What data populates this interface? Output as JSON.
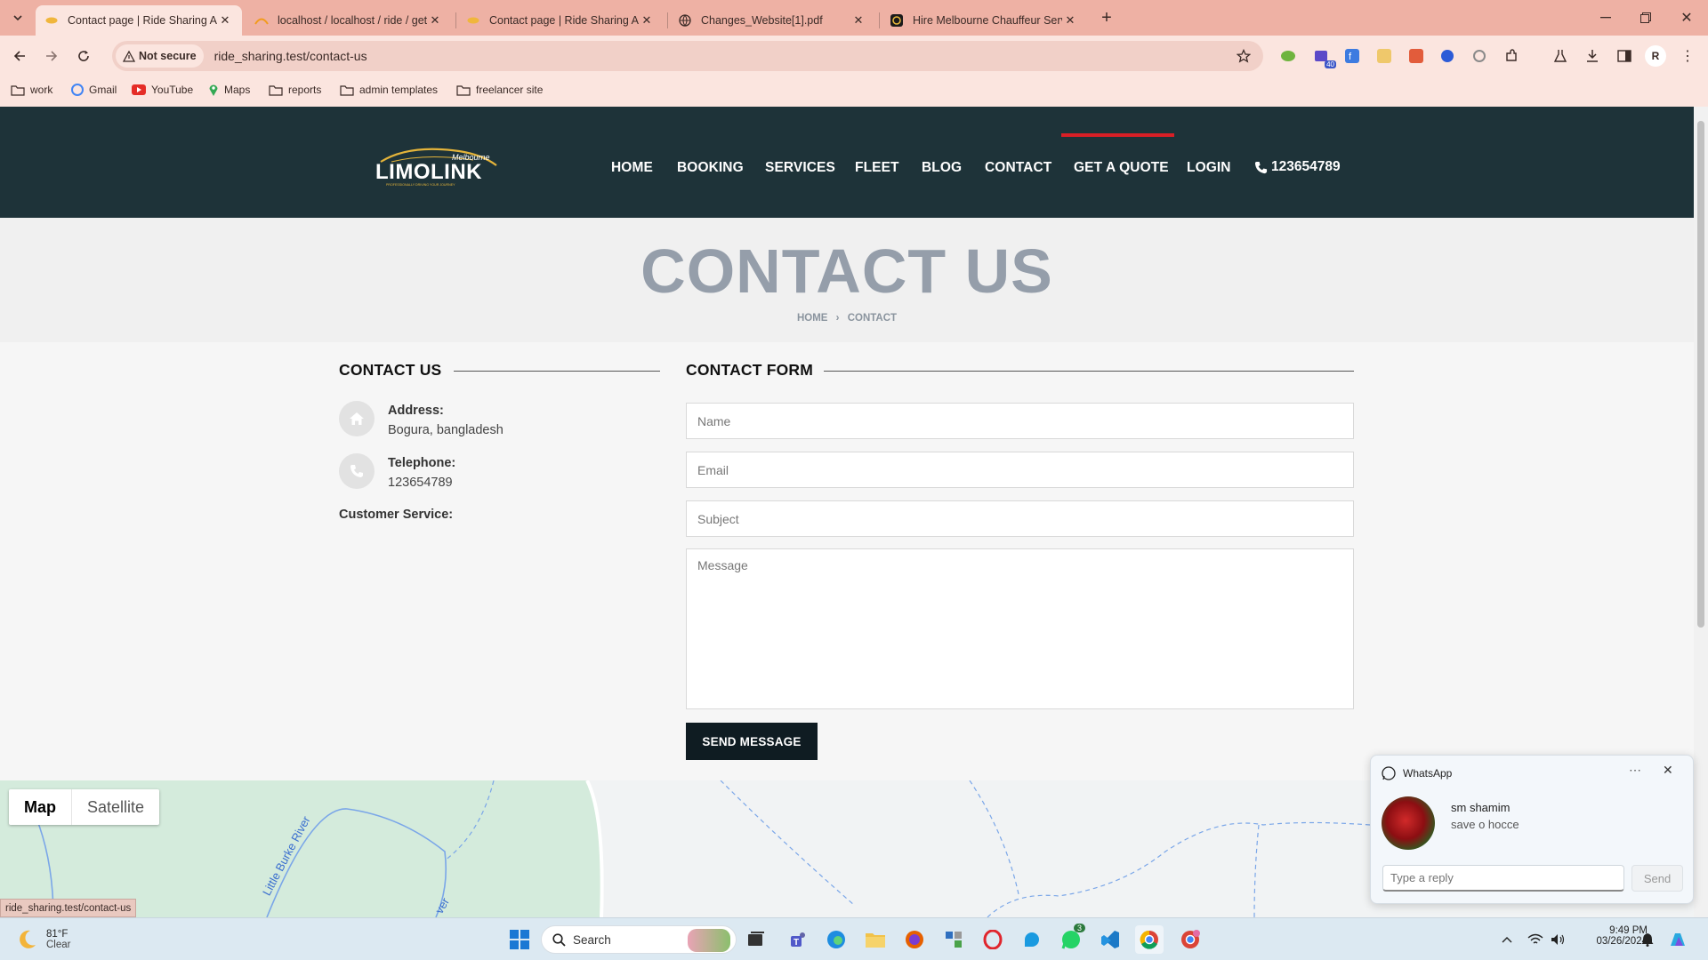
{
  "browser": {
    "tabs": [
      {
        "title": "Contact page | Ride Sharing Ap",
        "active": true
      },
      {
        "title": "localhost / localhost / ride / get",
        "active": false
      },
      {
        "title": "Contact page | Ride Sharing Ap",
        "active": false
      },
      {
        "title": "Changes_Website[1].pdf",
        "active": false
      },
      {
        "title": "Hire Melbourne Chauffeur Serv",
        "active": false
      }
    ],
    "security_label": "Not secure",
    "url": "ride_sharing.test/contact-us",
    "profile_initial": "R",
    "extension_badge": "40",
    "bookmarks": [
      "work",
      "Gmail",
      "YouTube",
      "Maps",
      "reports",
      "admin templates",
      "freelancer site"
    ]
  },
  "site": {
    "logo": {
      "top": "Melbourne",
      "main": "LIMOLINK",
      "tagline": "PROFESSIONALLY DRIVING YOUR JOURNEY"
    },
    "nav": [
      "HOME",
      "BOOKING",
      "SERVICES",
      "FLEET",
      "BLOG",
      "CONTACT",
      "GET A QUOTE",
      "LOGIN"
    ],
    "phone": "123654789",
    "hero_title": "CONTACT US",
    "breadcrumb": {
      "home": "HOME",
      "current": "CONTACT"
    }
  },
  "contact_info": {
    "heading": "CONTACT US",
    "address_label": "Address:",
    "address_value": "Bogura, bangladesh",
    "telephone_label": "Telephone:",
    "telephone_value": "123654789",
    "customer_service_label": "Customer Service:"
  },
  "contact_form": {
    "heading": "CONTACT FORM",
    "name_placeholder": "Name",
    "email_placeholder": "Email",
    "subject_placeholder": "Subject",
    "message_placeholder": "Message",
    "submit_label": "SEND MESSAGE"
  },
  "map": {
    "view_map": "Map",
    "view_satellite": "Satellite",
    "river_label": "Little Burke River",
    "river_label_2": "ver"
  },
  "status_url": "ride_sharing.test/contact-us",
  "whatsapp": {
    "app": "WhatsApp",
    "sender": "sm shamim",
    "message": "save o hocce",
    "reply_placeholder": "Type a reply",
    "send_label": "Send"
  },
  "taskbar": {
    "weather_temp": "81°F",
    "weather_desc": "Clear",
    "search_placeholder": "Search",
    "whatsapp_badge": "3",
    "time": "9:49 PM",
    "date": "03/26/2024"
  },
  "colors": {
    "header_bg": "#1e3339",
    "accent": "#d91f26",
    "tab_bg": "#eeb1a4",
    "button_bg": "#0f1c22"
  }
}
